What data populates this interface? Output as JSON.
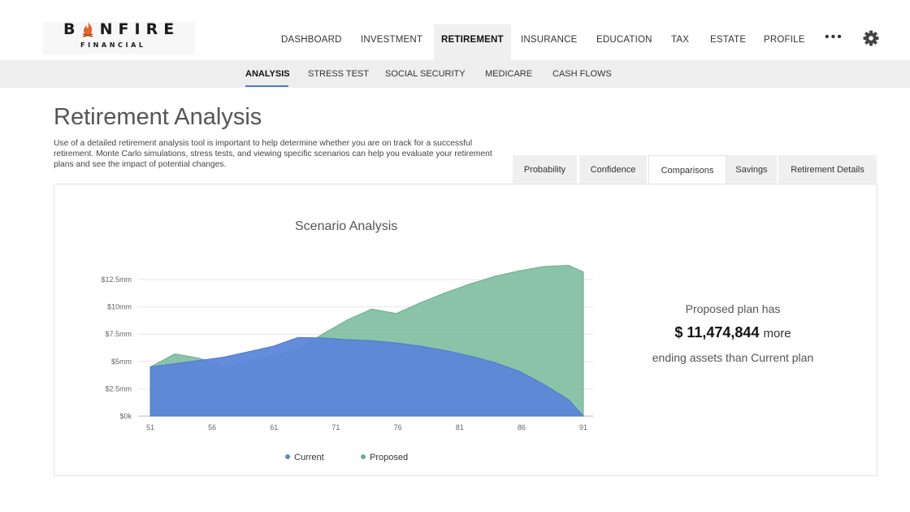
{
  "brand": {
    "name": "BONFIRE",
    "sub": "FINANCIAL"
  },
  "main_nav": [
    "DASHBOARD",
    "INVESTMENT",
    "RETIREMENT",
    "INSURANCE",
    "EDUCATION",
    "TAX",
    "ESTATE",
    "PROFILE"
  ],
  "main_nav_active": "RETIREMENT",
  "more_label": "•••",
  "sub_nav": [
    "ANALYSIS",
    "STRESS TEST",
    "SOCIAL SECURITY",
    "MEDICARE",
    "CASH FLOWS"
  ],
  "sub_nav_active": "ANALYSIS",
  "page": {
    "title": "Retirement Analysis",
    "description": "Use of a detailed retirement analysis tool is important to help determine whether you are on track for a successful retirement. Monte Carlo simulations, stress tests, and viewing specific scenarios can help you evaluate your retirement plans and see the impact of potential changes."
  },
  "tabs": [
    "Probability",
    "Confidence",
    "Comparisons",
    "Savings",
    "Retirement Details"
  ],
  "tabs_active": "Comparisons",
  "summary": {
    "line1": "Proposed plan has",
    "amount": "$ 11,474,844",
    "more": "more",
    "line3": "ending assets than Current plan"
  },
  "colors": {
    "current": "#5b86d8",
    "proposed": "#7dbd9f",
    "accent": "#4b7bd6",
    "flame": "#e0662e"
  },
  "chart_data": {
    "type": "area",
    "title": "Scenario Analysis",
    "xlabel": "",
    "ylabel": "",
    "x_ticks": [
      51,
      56,
      61,
      71,
      76,
      81,
      86,
      91
    ],
    "y_ticks": [
      "$0k",
      "$2.5mm",
      "$5mm",
      "$7.5mm",
      "$10mm",
      "$12.5mm"
    ],
    "ylim": [
      0,
      13.5
    ],
    "y_unit": "$mm",
    "legend": "bottom-center",
    "grid": true,
    "series": [
      {
        "name": "Current",
        "points": [
          [
            0,
            4.5
          ],
          [
            1,
            4.8
          ],
          [
            2,
            5.1
          ],
          [
            3,
            5.4
          ],
          [
            4,
            5.9
          ],
          [
            5,
            6.4
          ],
          [
            6,
            7.2
          ],
          [
            7,
            7.15
          ],
          [
            8,
            7.0
          ],
          [
            9,
            6.9
          ],
          [
            10,
            6.7
          ],
          [
            11,
            6.4
          ],
          [
            12,
            6.0
          ],
          [
            13,
            5.5
          ],
          [
            14,
            4.9
          ],
          [
            15,
            4.1
          ],
          [
            16,
            2.9
          ],
          [
            17,
            1.5
          ],
          [
            17.6,
            0
          ]
        ]
      },
      {
        "name": "Proposed",
        "points": [
          [
            0,
            4.5
          ],
          [
            1,
            5.7
          ],
          [
            2,
            5.3
          ],
          [
            3,
            4.5
          ],
          [
            4,
            5.0
          ],
          [
            5,
            5.5
          ],
          [
            6,
            6.1
          ],
          [
            7,
            7.5
          ],
          [
            8,
            8.8
          ],
          [
            9,
            9.8
          ],
          [
            10,
            9.4
          ],
          [
            11,
            10.4
          ],
          [
            12,
            11.3
          ],
          [
            13,
            12.1
          ],
          [
            14,
            12.8
          ],
          [
            15,
            13.3
          ],
          [
            16,
            13.7
          ],
          [
            17,
            13.8
          ],
          [
            17.6,
            13.2
          ],
          [
            17.6,
            0
          ]
        ]
      }
    ]
  }
}
